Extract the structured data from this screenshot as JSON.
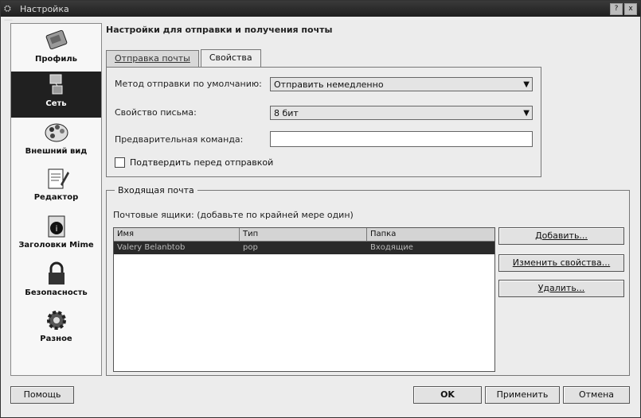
{
  "window": {
    "title": "Настройка",
    "close_glyph": "x",
    "help_glyph": "?"
  },
  "sidebar": {
    "items": [
      {
        "label": "Профиль",
        "icon": "profile-icon",
        "selected": false
      },
      {
        "label": "Сеть",
        "icon": "network-icon",
        "selected": true
      },
      {
        "label": "Внешний вид",
        "icon": "palette-icon",
        "selected": false
      },
      {
        "label": "Редактор",
        "icon": "editor-icon",
        "selected": false
      },
      {
        "label": "Заголовки Mime",
        "icon": "mime-icon",
        "selected": false
      },
      {
        "label": "Безопасность",
        "icon": "lock-icon",
        "selected": false
      },
      {
        "label": "Разное",
        "icon": "gear-icon",
        "selected": false
      }
    ]
  },
  "main": {
    "section_title": "Настройки для отправки и получения почты",
    "tabs": [
      {
        "label": "Отправка почты",
        "active": false
      },
      {
        "label": "Свойства",
        "active": true
      }
    ],
    "send_method": {
      "label": "Метод отправки по умолчанию:",
      "value": "Отправить немедленно"
    },
    "message_property": {
      "label": "Свойство письма:",
      "value": "8 бит"
    },
    "precommand": {
      "label": "Предварительная команда:",
      "value": ""
    },
    "confirm_checkbox": {
      "label": "Подтвердить перед отправкой",
      "checked": false
    },
    "incoming": {
      "title": "Входящая почта",
      "hint": "Почтовые ящики: (добавьте по крайней мере один)",
      "columns": [
        "Имя",
        "Тип",
        "Папка"
      ],
      "rows": [
        {
          "name": "Valery Belanbtob",
          "type": "pop",
          "folder": "Входящие"
        }
      ],
      "buttons": {
        "add": "Добавить...",
        "modify": "Изменить свойства...",
        "remove": "Удалить..."
      }
    }
  },
  "footer": {
    "help": "Помощь",
    "ok": "OK",
    "apply": "Применить",
    "cancel": "Отмена"
  }
}
